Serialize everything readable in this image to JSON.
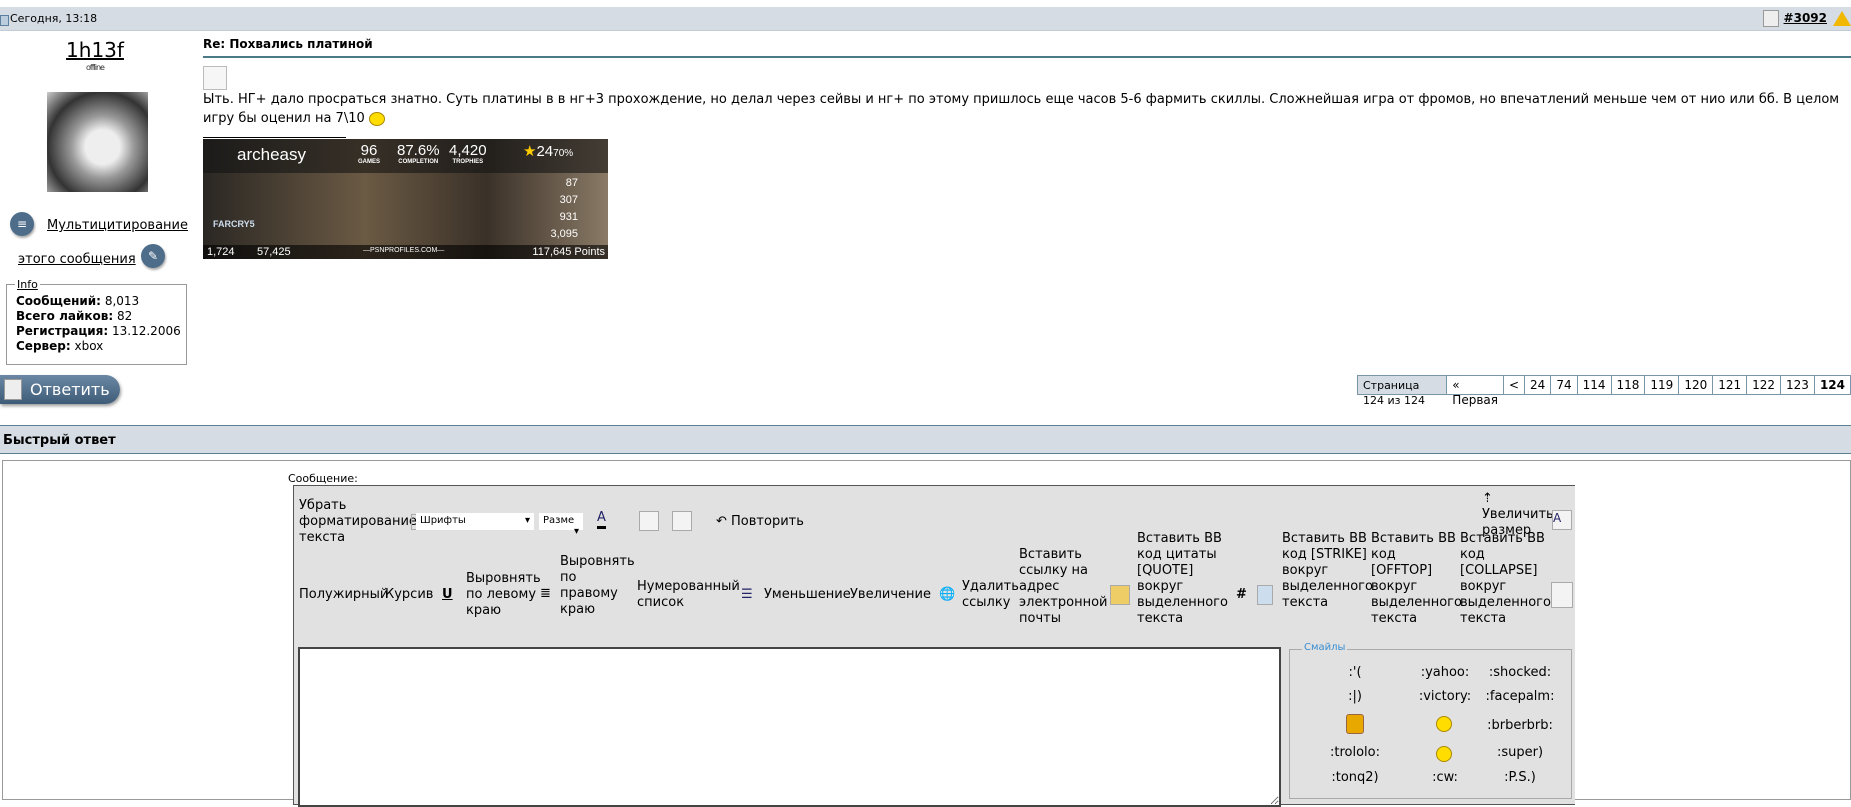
{
  "header": {
    "date": "Сегодня, 13:18",
    "post_number": "#3092"
  },
  "user": {
    "name": "1h13f",
    "status": "offline",
    "multiquote_1": "Мультицитирование",
    "multiquote_2": "этого сообщения",
    "info": {
      "legend": "Info",
      "rows": [
        {
          "label": "Сообщений:",
          "value": "8,013"
        },
        {
          "label": "Всего лайков:",
          "value": "82"
        },
        {
          "label": "Регистрация:",
          "value": "13.12.2006"
        },
        {
          "label": "Сервер:",
          "value": "xbox"
        }
      ]
    }
  },
  "post": {
    "title": "Re: Похвались платиной",
    "text": "Ыть. НГ+ дало просраться знатно. Суть платины в в нг+3 прохождение, но делал через сейвы и нг+ по этому пришлось еще часов 5-6 фармить скиллы. Сложнейшая игра от фромов, но впечатлений меньше чем от нио или бб. В целом игру бы оценил на 7\\10"
  },
  "signature": {
    "name": "archeasy",
    "games": "96",
    "games_lbl": "GAMES",
    "completion": "87.6%",
    "completion_lbl": "COMPLETION",
    "trophies": "4,420",
    "trophies_lbl": "TROPHIES",
    "level": "24",
    "level_pct": "70%",
    "platinum": "87",
    "gold": "307",
    "silver": "931",
    "bronze": "3,095",
    "rank": "1,724",
    "world": "57,425",
    "site": "—PSNPROFILES.COM—",
    "points": "117,645 Points",
    "game_label": "FARCRY5"
  },
  "reply_button": "Ответить",
  "pagination": {
    "label": "Страница 124 из 124",
    "first": "« Первая",
    "prev": "<",
    "pages": [
      "24",
      "74",
      "114",
      "118",
      "119",
      "120",
      "121",
      "122",
      "123",
      "124"
    ],
    "current": "124"
  },
  "quick_reply": {
    "title": "Быстрый ответ",
    "message_label": "Сообщение:"
  },
  "toolbar": {
    "remove_format": "Убрать форматирование текста",
    "font": "Шрифты",
    "size": "Разме",
    "redo": "Повторить",
    "enlarge": "Увеличить размер",
    "bold": "Полужирный",
    "italic": "Курсив",
    "underline": "U",
    "align_left": "Выровнять по левому краю",
    "align_right": "Выровнять по правому краю",
    "numbered": "Нумерованный список",
    "outdent": "Уменьшение",
    "indent": "Увеличение",
    "unlink": "Удалить ссылку",
    "email": "Вставить ссылку на адрес электронной почты",
    "quote": "Вставить BB код цитаты [QUOTE] вокруг выделенного текста",
    "hash": "#",
    "strike": "Вставить BB код [STRIKE] вокруг выделенного текста",
    "offtop": "Вставить BB код [OFFTOP] вокруг выделенного текста",
    "collapse": "Вставить BB код [COLLAPSE] вокруг выделенного текста"
  },
  "smilies": {
    "legend": "Смайлы",
    "items": [
      ":'(",
      ":yahoo:",
      ":shocked:",
      ":|)",
      ":victory:",
      ":facepalm:",
      ":brberbrb:",
      ":trololo:",
      ":super)",
      ":tonq2)",
      ":cw:",
      ":P.S.)"
    ]
  }
}
